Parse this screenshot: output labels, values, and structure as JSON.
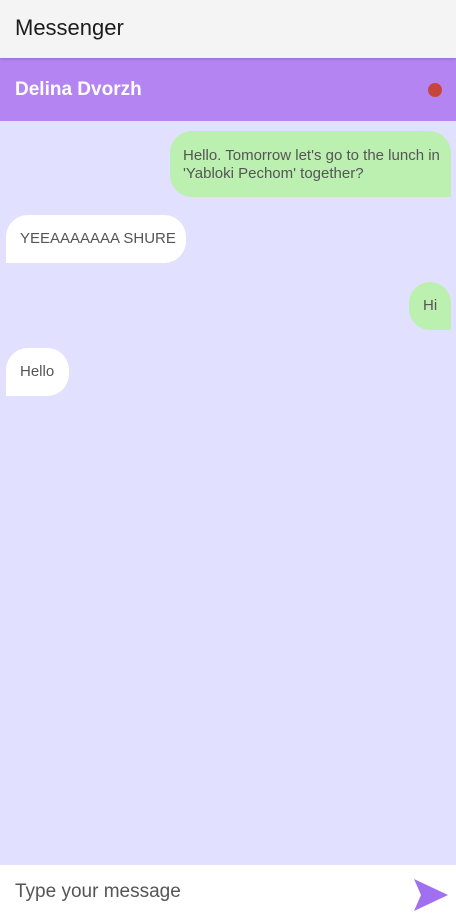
{
  "app": {
    "title": "Messenger"
  },
  "chat": {
    "contact_name": "Delina Dvorzh",
    "status_color": "#c8453b",
    "header_color": "#b485f2"
  },
  "messages": [
    {
      "direction": "outgoing",
      "text": "Hello. Tomorrow let's go to the lunch in 'Yabloki Pechom' together?"
    },
    {
      "direction": "incoming",
      "text": "YEEAAAAAAA SHURE"
    },
    {
      "direction": "outgoing",
      "text": "Hi"
    },
    {
      "direction": "incoming",
      "text": "Hello"
    }
  ],
  "composer": {
    "placeholder": "Type your message",
    "value": "",
    "send_icon": "send-icon"
  },
  "colors": {
    "background": "#e2e0ff",
    "outgoing_bubble": "#bbf0b0",
    "incoming_bubble": "#ffffff",
    "send_icon": "#a070f0"
  }
}
